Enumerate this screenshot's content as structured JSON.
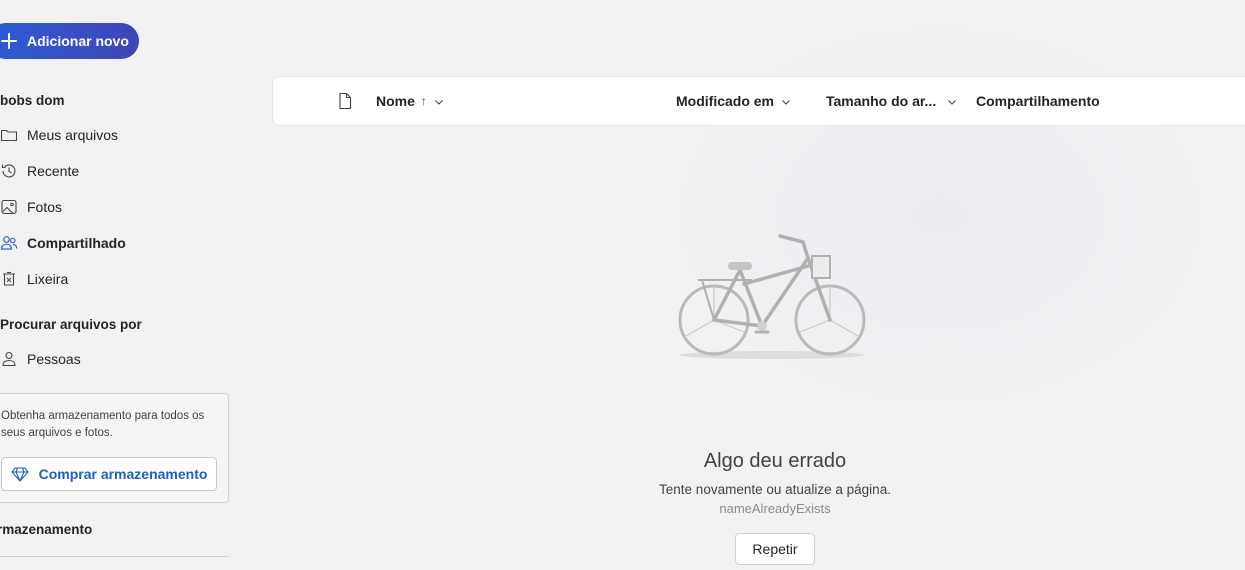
{
  "sidebar": {
    "add_button_label": "Adicionar novo",
    "account_name": "bobs dom",
    "nav_items": [
      {
        "label": "Meus arquivos",
        "icon": "folder-icon"
      },
      {
        "label": "Recente",
        "icon": "history-icon"
      },
      {
        "label": "Fotos",
        "icon": "image-icon"
      },
      {
        "label": "Compartilhado",
        "icon": "people-icon"
      },
      {
        "label": "Lixeira",
        "icon": "trash-icon"
      }
    ],
    "browse_title": "Procurar arquivos por",
    "browse_items": [
      {
        "label": "Pessoas",
        "icon": "person-icon"
      }
    ],
    "storage_promo_text": "Obtenha armazenamento para todos os seus arquivos e fotos.",
    "buy_storage_label": "Comprar armazenamento",
    "storage_title": "rmazenamento"
  },
  "list_header": {
    "name_label": "Nome",
    "name_sort_indicator": "↑",
    "modified_label": "Modificado em",
    "size_label": "Tamanho do ar...",
    "sharing_label": "Compartilhamento"
  },
  "empty_state": {
    "title": "Algo deu errado",
    "message": "Tente novamente ou atualize a página.",
    "code": "nameAlreadyExists",
    "retry_label": "Repetir"
  },
  "colors": {
    "accent": "#2b5bd4",
    "link": "#1f5fbf"
  }
}
